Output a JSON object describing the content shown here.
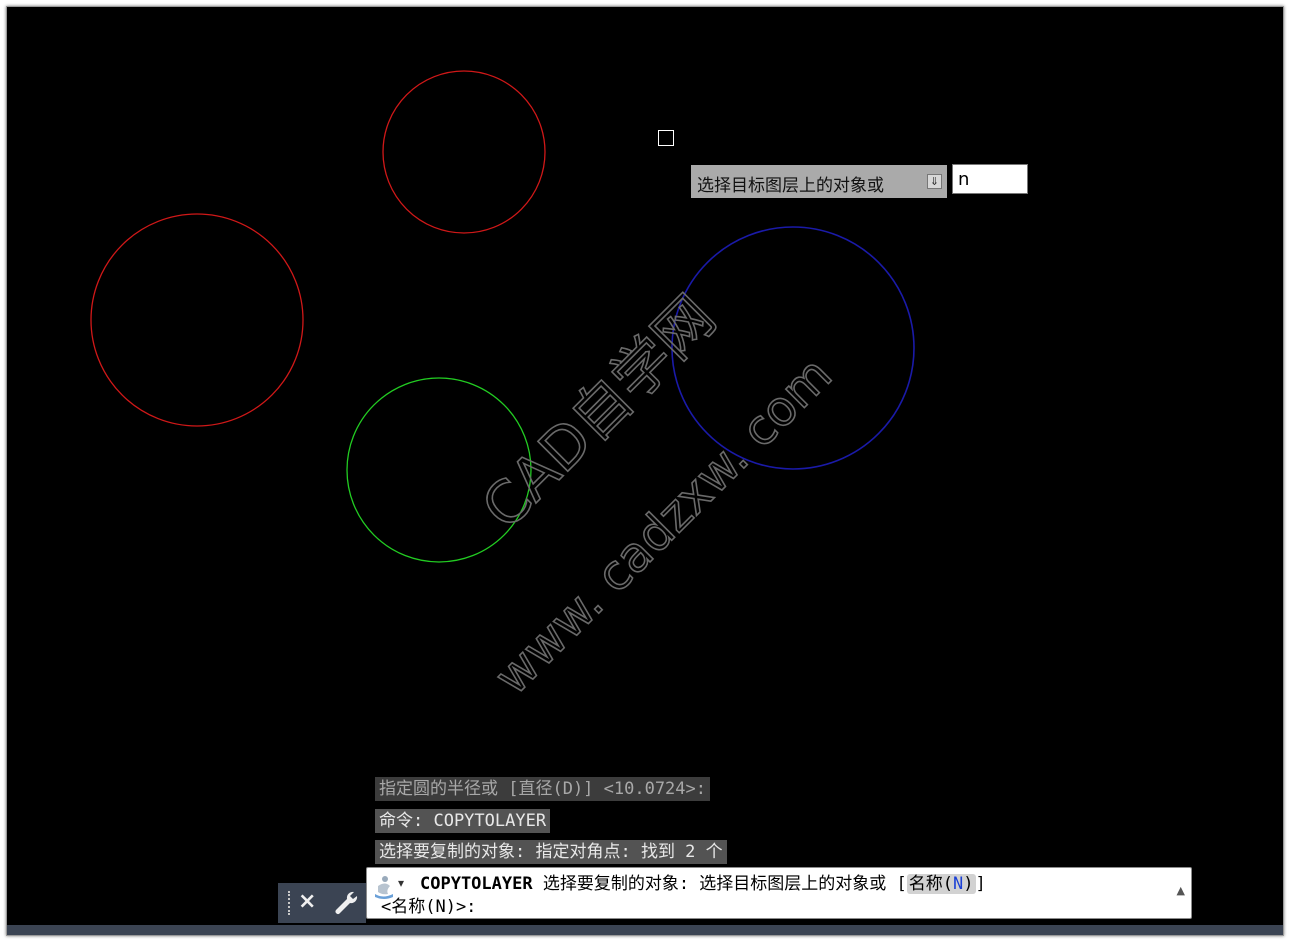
{
  "canvas": {
    "background": "#000000",
    "circles": [
      {
        "name": "circle-red-top",
        "color": "#d01818"
      },
      {
        "name": "circle-red-left",
        "color": "#d01818"
      },
      {
        "name": "circle-green",
        "color": "#22cc22"
      },
      {
        "name": "circle-blue",
        "color": "#1a1aa8"
      }
    ],
    "watermark": {
      "line1": "CAD自学网",
      "line2": "www. cadzxw. com",
      "color": "#6a6a6a"
    }
  },
  "dynamic_prompt": {
    "text": "选择目标图层上的对象或",
    "option_icon": "arrow-down-icon",
    "input_value": "n"
  },
  "history": {
    "line1": "指定圆的半径或 [直径(D)] <10.0724>:",
    "line2": "命令: COPYTOLAYER",
    "line3": "选择要复制的对象: 指定对角点: 找到 2 个"
  },
  "command_line": {
    "command_name": "COPYTOLAYER",
    "prompt1": " 选择要复制的对象:  选择目标图层上的对象或 [",
    "option_label": "名称(",
    "option_key": "N",
    "option_close": ")",
    "prompt_end": "]",
    "row2": "<名称(N)>:",
    "close_icon": "×",
    "arrow": "▾",
    "scroll": "▲"
  }
}
